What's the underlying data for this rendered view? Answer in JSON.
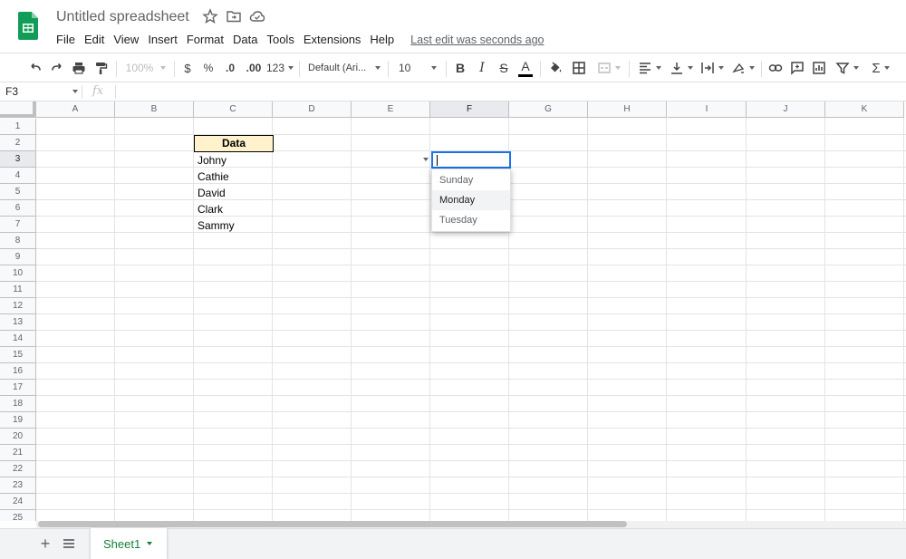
{
  "app": {
    "title": "Untitled spreadsheet",
    "last_edit": "Last edit was seconds ago",
    "brand_color": "#0f9d58"
  },
  "menu": [
    "File",
    "Edit",
    "View",
    "Insert",
    "Format",
    "Data",
    "Tools",
    "Extensions",
    "Help"
  ],
  "toolbar": {
    "zoom": "100%",
    "currency": "$",
    "percent": "%",
    "decrease_decimal": ".0",
    "increase_decimal": ".00",
    "more_formats": "123",
    "font": "Default (Ari...",
    "font_size": "10",
    "bold": "B",
    "italic": "I",
    "strike": "S",
    "text_color": "A",
    "sum": "Σ"
  },
  "formula_bar": {
    "name_box": "F3",
    "fx": "fx"
  },
  "grid": {
    "columns": [
      "A",
      "B",
      "C",
      "D",
      "E",
      "F",
      "G",
      "H",
      "I",
      "J",
      "K"
    ],
    "rows": [
      "1",
      "2",
      "3",
      "4",
      "5",
      "6",
      "7",
      "8",
      "9",
      "10",
      "11",
      "12",
      "13",
      "14",
      "15",
      "16",
      "17",
      "18",
      "19",
      "20",
      "21",
      "22",
      "23",
      "24",
      "25"
    ],
    "selected_column": "F",
    "selected_row": "3",
    "header_cell": "Data",
    "header_fill": "#fff2cc",
    "names": [
      "Johny",
      "Cathie",
      "David",
      "Clark",
      "Sammy"
    ]
  },
  "dropdown": {
    "options": [
      "Sunday",
      "Monday",
      "Tuesday"
    ],
    "highlighted": "Monday"
  },
  "sheets": {
    "active": "Sheet1"
  }
}
